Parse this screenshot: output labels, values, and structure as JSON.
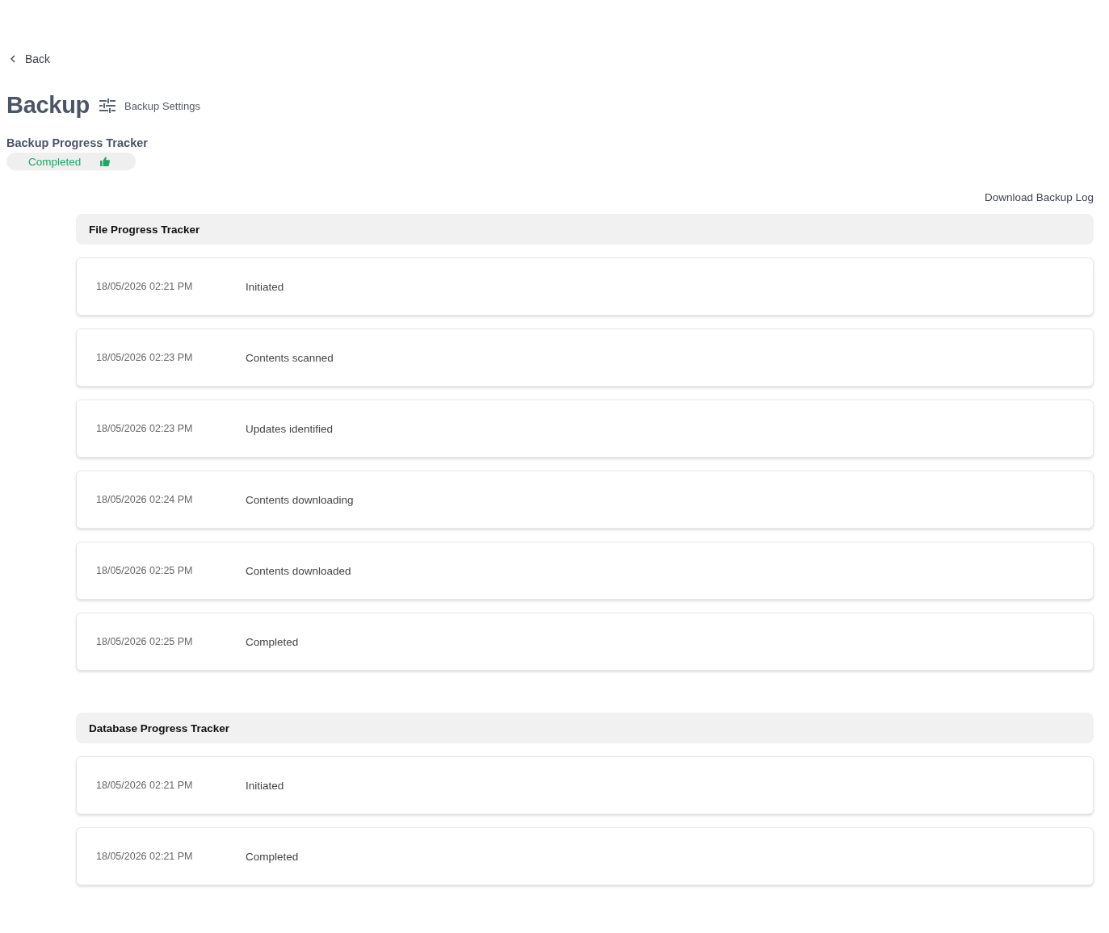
{
  "back": {
    "label": "Back"
  },
  "header": {
    "title": "Backup",
    "settings_link": "Backup Settings"
  },
  "tracker": {
    "title": "Backup Progress Tracker",
    "status": {
      "label": "Completed",
      "kind": "success"
    }
  },
  "download_link": "Download Backup Log",
  "sections": [
    {
      "title": "File Progress Tracker",
      "events": [
        {
          "time": "18/05/2026 02:21 PM",
          "label": "Initiated"
        },
        {
          "time": "18/05/2026 02:23 PM",
          "label": "Contents scanned"
        },
        {
          "time": "18/05/2026 02:23 PM",
          "label": "Updates identified"
        },
        {
          "time": "18/05/2026 02:24 PM",
          "label": "Contents downloading"
        },
        {
          "time": "18/05/2026 02:25 PM",
          "label": "Contents downloaded"
        },
        {
          "time": "18/05/2026 02:25 PM",
          "label": "Completed"
        }
      ]
    },
    {
      "title": "Database Progress Tracker",
      "events": [
        {
          "time": "18/05/2026 02:21 PM",
          "label": "Initiated"
        },
        {
          "time": "18/05/2026 02:21 PM",
          "label": "Completed"
        }
      ]
    }
  ]
}
